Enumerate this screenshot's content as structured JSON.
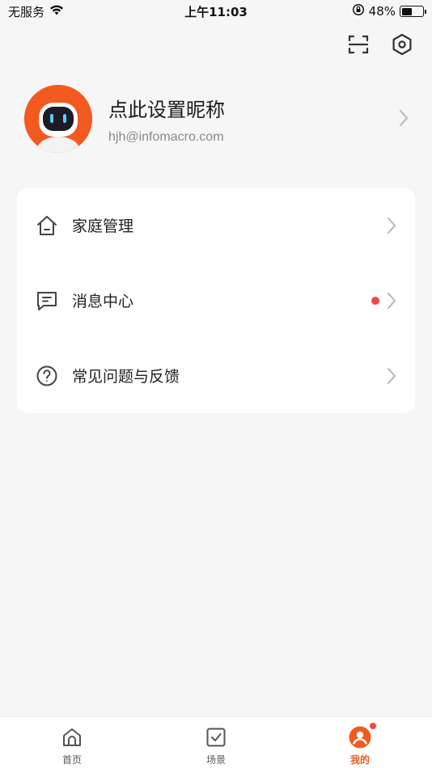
{
  "status_bar": {
    "carrier": "无服务",
    "time": "上午11:03",
    "battery_percent": "48%",
    "battery_level": 0.48
  },
  "top_actions": {
    "scan_icon": "scan-icon",
    "settings_icon": "settings-hexagon-icon"
  },
  "profile": {
    "nickname": "点此设置昵称",
    "email": "hjh@infomacro.com",
    "avatar_color": "#f25a1f"
  },
  "menu": {
    "items": [
      {
        "label": "家庭管理",
        "icon": "home-icon",
        "badge": false
      },
      {
        "label": "消息中心",
        "icon": "message-icon",
        "badge": true
      },
      {
        "label": "常见问题与反馈",
        "icon": "help-icon",
        "badge": false
      }
    ]
  },
  "tab_bar": {
    "tabs": [
      {
        "label": "首页",
        "icon": "home-tab-icon",
        "active": false
      },
      {
        "label": "场景",
        "icon": "scene-check-icon",
        "active": false
      },
      {
        "label": "我的",
        "icon": "profile-tab-icon",
        "active": true,
        "badge": true
      }
    ]
  },
  "colors": {
    "accent": "#f25a1f",
    "badge": "#f04848",
    "background": "#f6f6f6"
  }
}
